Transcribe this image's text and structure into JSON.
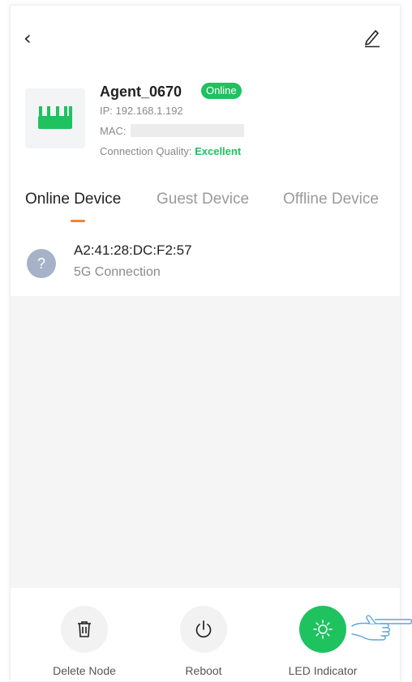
{
  "header": {
    "back_icon": "chevron-left-icon",
    "edit_icon": "pencil-icon"
  },
  "node": {
    "name": "Agent_0670",
    "status": "Online",
    "ip_label": "IP:",
    "ip_value": "192.168.1.192",
    "mac_label": "MAC:",
    "quality_label": "Connection Quality:",
    "quality_value": "Excellent",
    "icon": "router-icon"
  },
  "tabs": [
    {
      "label": "Online Device",
      "active": true
    },
    {
      "label": "Guest Device",
      "active": false
    },
    {
      "label": "Offline Device",
      "active": false
    }
  ],
  "devices": [
    {
      "mac": "A2:41:28:DC:F2:57",
      "connection": "5G Connection",
      "icon": "question-icon"
    }
  ],
  "actions": [
    {
      "label": "Delete Node",
      "icon": "trash-icon"
    },
    {
      "label": "Reboot",
      "icon": "power-icon"
    },
    {
      "label": "LED Indicator",
      "icon": "sun-icon"
    }
  ],
  "colors": {
    "accent_green": "#1ec25e",
    "tab_indicator": "#e8873a",
    "unknown_device": "#a5b2c7"
  }
}
